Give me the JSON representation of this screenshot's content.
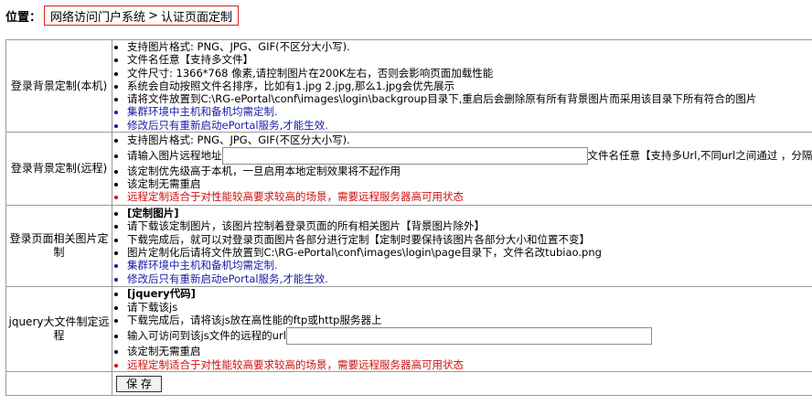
{
  "breadcrumb": {
    "label": "位置：",
    "path": [
      "网络访问门户系统",
      "认证页面定制"
    ],
    "separator": ">"
  },
  "rows": [
    {
      "label": "登录背景定制(本机)",
      "items": [
        {
          "text": "支持图片格式: PNG、JPG、GIF(不区分大小写).",
          "style": ""
        },
        {
          "text": "文件名任意【支持多文件】",
          "style": ""
        },
        {
          "text": "文件尺寸: 1366*768 像素,请控制图片在200K左右，否则会影响页面加载性能",
          "style": ""
        },
        {
          "text": "系统会自动按照文件名排序，比如有1.jpg 2.jpg,那么1.jpg会优先展示",
          "style": ""
        },
        {
          "text": "请将文件放置到C:\\RG-ePortal\\conf\\images\\login\\backgroup目录下,重启后会删除原有所有背景图片而采用该目录下所有符合的图片",
          "style": ""
        },
        {
          "text": "集群环境中主机和备机均需定制.",
          "style": "blue"
        },
        {
          "text": "修改后只有重新启动ePortal服务,才能生效.",
          "style": "blue"
        }
      ]
    },
    {
      "label": "登录背景定制(远程)",
      "items": [
        {
          "text": "支持图片格式: PNG、JPG、GIF(不区分大小写).",
          "style": ""
        },
        {
          "text": "请输入图片远程地址",
          "style": "",
          "input_after": "文件名任意【支持多Url,不同url之间通过 ，分隔】"
        },
        {
          "text": "该定制优先级高于本机，一旦启用本地定制效果将不起作用",
          "style": ""
        },
        {
          "text": "该定制无需重启",
          "style": ""
        },
        {
          "text": "远程定制适合于对性能较高要求较高的场景，需要远程服务器高可用状态",
          "style": "red"
        }
      ]
    },
    {
      "label": "登录页面相关图片定制",
      "items": [
        {
          "text": "[定制图片]",
          "style": "bold"
        },
        {
          "text": "请下载该定制图片，该图片控制着登录页面的所有相关图片【背景图片除外】",
          "style": ""
        },
        {
          "text": "下载完成后，就可以对登录页面图片各部分进行定制【定制时要保持该图片各部分大小和位置不变】",
          "style": ""
        },
        {
          "text": "图片定制化后请将文件放置到C:\\RG-ePortal\\conf\\images\\login\\page目录下，文件名改tubiao.png",
          "style": ""
        },
        {
          "text": "集群环境中主机和备机均需定制.",
          "style": "blue"
        },
        {
          "text": "修改后只有重新启动ePortal服务,才能生效.",
          "style": "blue"
        }
      ]
    },
    {
      "label": "jquery大文件制定远程",
      "items": [
        {
          "text": "[jquery代码]",
          "style": "bold"
        },
        {
          "text": "请下载该js",
          "style": ""
        },
        {
          "text": "下载完成后，请将该js放在高性能的ftp或http服务器上",
          "style": ""
        },
        {
          "text": "输入可访问到该js文件的远程的url",
          "style": "",
          "input_after": ""
        },
        {
          "text": "该定制无需重启",
          "style": ""
        },
        {
          "text": "远程定制适合于对性能较高要求较高的场景，需要远程服务器高可用状态",
          "style": "red"
        }
      ]
    }
  ],
  "save_label": "保 存",
  "colors": {
    "blue_text": "#1a1aa8",
    "red_text": "#cc1010",
    "breadcrumb_border": "#e02020"
  }
}
